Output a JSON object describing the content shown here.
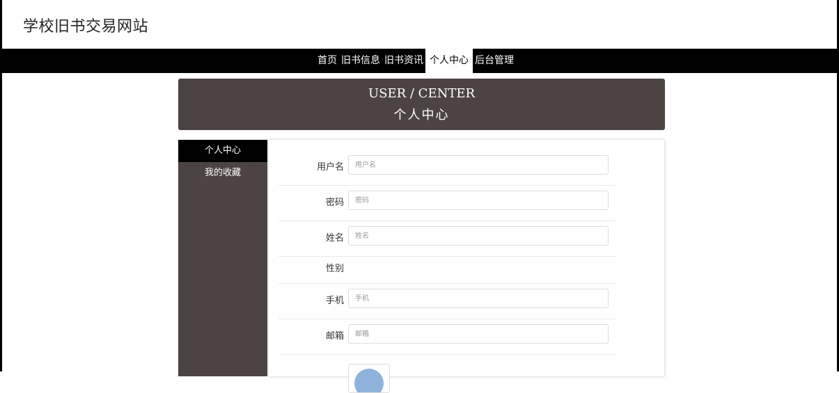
{
  "site": {
    "title": "学校旧书交易网站"
  },
  "nav": {
    "items": [
      {
        "label": "首页",
        "active": false
      },
      {
        "label": "旧书信息",
        "active": false
      },
      {
        "label": "旧书资讯",
        "active": false
      },
      {
        "label": "个人中心",
        "active": true
      },
      {
        "label": "后台管理",
        "active": false
      }
    ]
  },
  "banner": {
    "title_en": "USER / CENTER",
    "title_cn": "个人中心"
  },
  "sidebar": {
    "items": [
      {
        "label": "个人中心",
        "active": true
      },
      {
        "label": "我的收藏",
        "active": false
      }
    ]
  },
  "form": {
    "username": {
      "label": "用户名",
      "placeholder": "用户名",
      "value": ""
    },
    "password": {
      "label": "密码",
      "placeholder": "密码",
      "value": ""
    },
    "name": {
      "label": "姓名",
      "placeholder": "姓名",
      "value": ""
    },
    "gender": {
      "label": "性别"
    },
    "phone": {
      "label": "手机",
      "placeholder": "手机",
      "value": ""
    },
    "email": {
      "label": "邮箱",
      "placeholder": "邮箱",
      "value": ""
    }
  },
  "colors": {
    "banner_bg": "#4c4443",
    "nav_bg": "#000000",
    "avatar": "#8fb3dc"
  },
  "icons": {
    "avatar": "user-avatar-icon"
  }
}
